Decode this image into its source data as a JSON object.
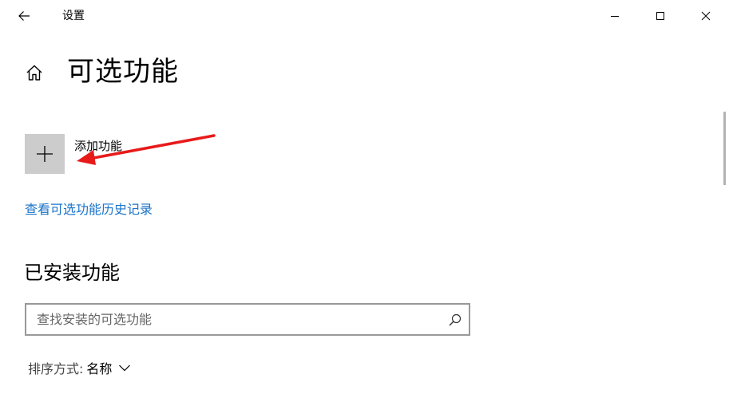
{
  "window": {
    "title": "设置"
  },
  "titlebar": {
    "back_icon": "arrow-left-icon",
    "minimize_icon": "minimize-icon",
    "maximize_icon": "maximize-icon",
    "close_icon": "close-icon"
  },
  "header": {
    "home_icon": "home-icon",
    "title": "可选功能"
  },
  "add_feature": {
    "icon": "plus-icon",
    "label": "添加功能"
  },
  "annotation": {
    "color": "#e81a1a"
  },
  "history_link": {
    "label": "查看可选功能历史记录",
    "color": "#1a73c8"
  },
  "installed": {
    "title": "已安装功能",
    "search": {
      "placeholder": "查找安装的可选功能",
      "value": "",
      "icon": "search-icon"
    },
    "sort": {
      "label": "排序方式:",
      "value": "名称",
      "icon": "chevron-down-icon"
    }
  }
}
